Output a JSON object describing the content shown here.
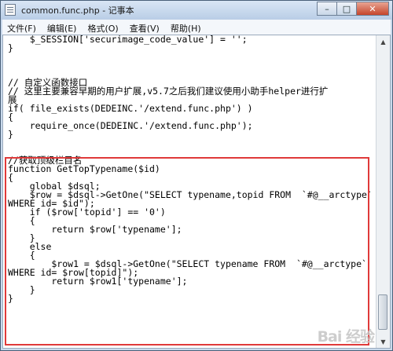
{
  "window": {
    "title": "common.func.php - 记事本",
    "buttons": {
      "minimize": "–",
      "maximize": "□",
      "close": "✕"
    }
  },
  "menu": [
    "文件(F)",
    "编辑(E)",
    "格式(O)",
    "查看(V)",
    "帮助(H)"
  ],
  "editor": {
    "code": "    $_SESSION['securimage_code_value'] = '';\n}\n\n\n\n// 自定义函数接口\n// 这里主要兼容早期的用户扩展,v5.7之后我们建议使用小助手helper进行扩\n展\nif( file_exists(DEDEINC.'/extend.func.php') )\n{\n    require_once(DEDEINC.'/extend.func.php');\n}\n\n\n//获取顶级栏目名\nfunction GetTopTypename($id)\n{\n    global $dsql;\n    $row = $dsql->GetOne(\"SELECT typename,topid FROM  `#@__arctype`\nWHERE id= $id\");\n    if ($row['topid'] == '0')\n    {\n        return $row['typename'];\n    }\n    else\n    {\n        $row1 = $dsql->GetOne(\"SELECT typename FROM  `#@__arctype`\nWHERE id= $row[topid]\");\n        return $row1['typename'];\n    }\n}"
  },
  "watermark": "Bai 经验"
}
